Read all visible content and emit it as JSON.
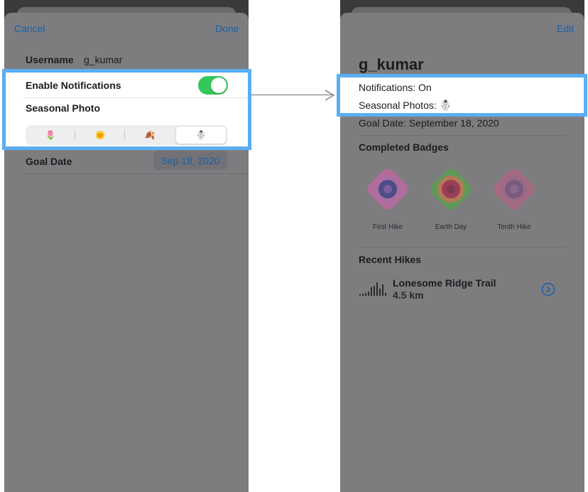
{
  "left_screen": {
    "cancel_label": "Cancel",
    "done_label": "Done",
    "username_label": "Username",
    "username_value": "g_kumar",
    "notifications_label": "Enable Notifications",
    "notifications_enabled": true,
    "seasonal_photo_label": "Seasonal Photo",
    "seasons": [
      "🌷",
      "🌞",
      "🍂",
      "☃️"
    ],
    "selected_season_index": 3,
    "goal_date_label": "Goal Date",
    "goal_date_value": "Sep 18, 2020"
  },
  "right_screen": {
    "edit_label": "Edit",
    "username": "g_kumar",
    "notifications_text": "Notifications: On",
    "seasonal_photos_text": "Seasonal Photos: ☃️",
    "goal_date_text": "Goal Date: September 18, 2020",
    "completed_badges_heading": "Completed Badges",
    "badges": [
      {
        "name": "First Hike",
        "color": "#c45ea8"
      },
      {
        "name": "Earth Day",
        "color": "#4fae5a"
      },
      {
        "name": "Tenth Hike",
        "color": "#b7568f"
      }
    ],
    "recent_hikes_heading": "Recent Hikes",
    "hike_name": "Lonesome Ridge Trail",
    "hike_distance": "4.5 km"
  },
  "colors": {
    "highlight_border": "#5aaef2",
    "toggle_on": "#34c759",
    "link_blue": "#1a5fa8"
  }
}
